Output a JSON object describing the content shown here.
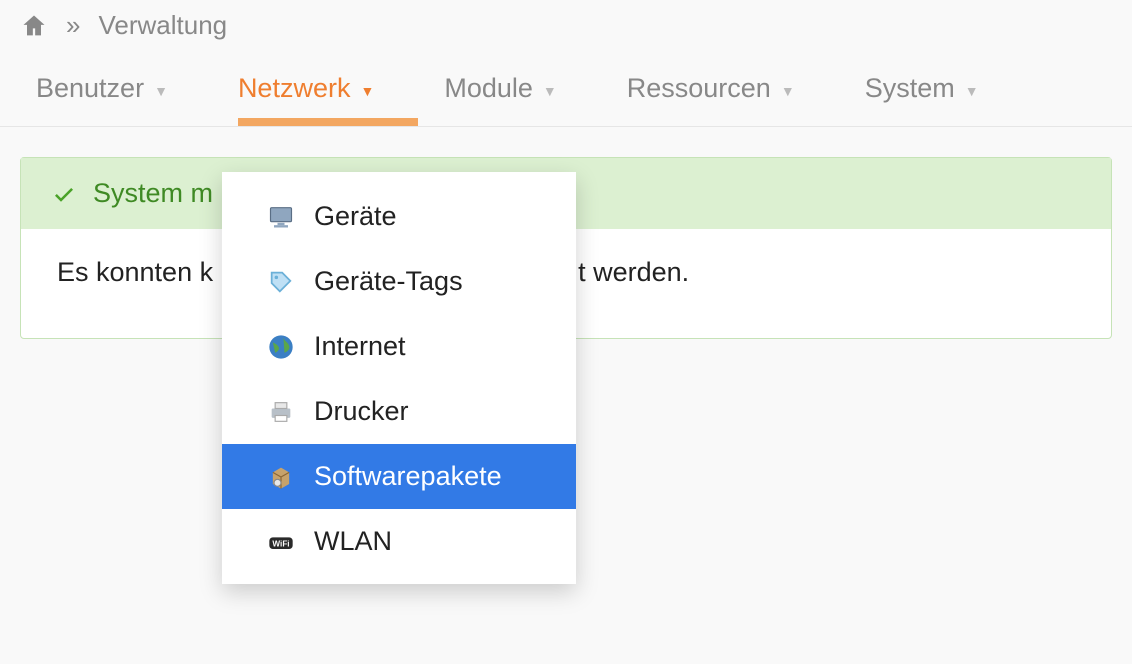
{
  "breadcrumb": {
    "separator": "»",
    "current": "Verwaltung"
  },
  "nav": {
    "items": [
      {
        "label": "Benutzer",
        "active": false
      },
      {
        "label": "Netzwerk",
        "active": true
      },
      {
        "label": "Module",
        "active": false
      },
      {
        "label": "Ressourcen",
        "active": false
      },
      {
        "label": "System",
        "active": false
      }
    ]
  },
  "dropdown": {
    "items": [
      {
        "label": "Geräte",
        "icon": "device-icon",
        "selected": false
      },
      {
        "label": "Geräte-Tags",
        "icon": "tag-icon",
        "selected": false
      },
      {
        "label": "Internet",
        "icon": "globe-icon",
        "selected": false
      },
      {
        "label": "Drucker",
        "icon": "printer-icon",
        "selected": false
      },
      {
        "label": "Softwarepakete",
        "icon": "package-icon",
        "selected": true
      },
      {
        "label": "WLAN",
        "icon": "wifi-icon",
        "selected": false
      }
    ]
  },
  "panel": {
    "title_visible_fragment": "System m",
    "body_fragment_left": "Es konnten k",
    "body_fragment_right": "t werden."
  },
  "colors": {
    "accent": "#ef7e2f",
    "success_bg": "#dcf0d1",
    "success_text": "#3f8a24",
    "dropdown_selected": "#327ae6"
  }
}
